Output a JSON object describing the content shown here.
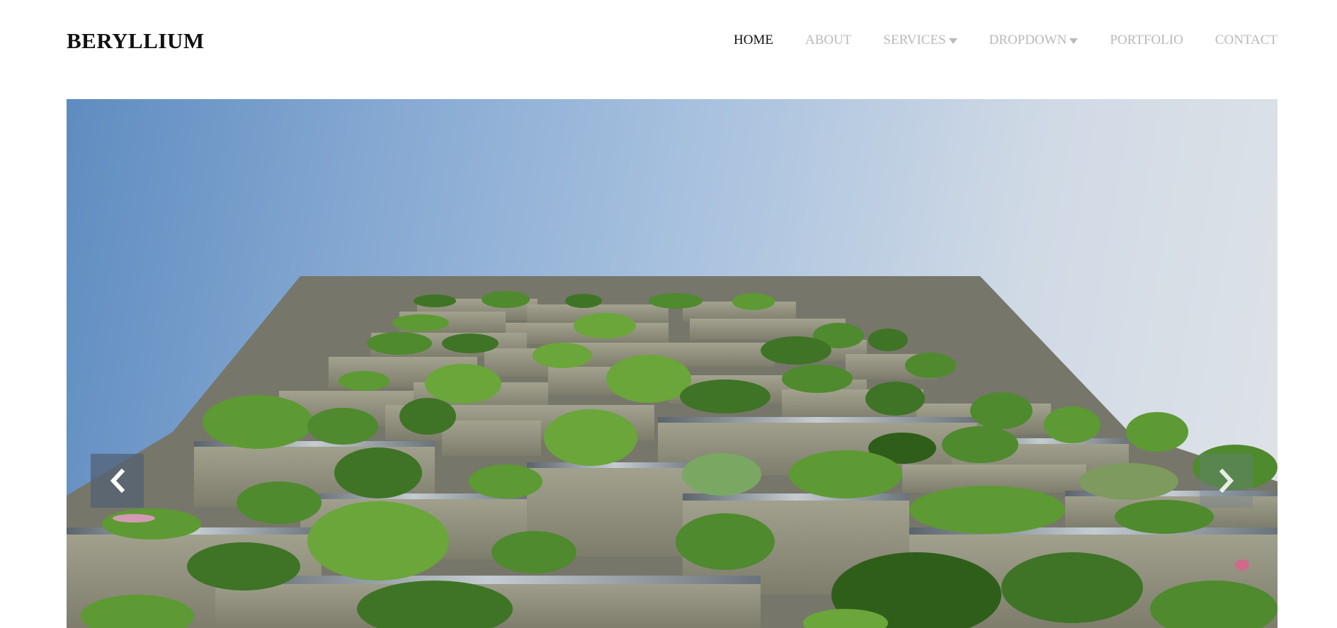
{
  "brand": "BERYLLIUM",
  "nav": {
    "items": [
      {
        "label": "HOME",
        "active": true,
        "dropdown": false
      },
      {
        "label": "ABOUT",
        "active": false,
        "dropdown": false
      },
      {
        "label": "SERVICES",
        "active": false,
        "dropdown": true
      },
      {
        "label": "DROPDOWN",
        "active": false,
        "dropdown": true
      },
      {
        "label": "PORTFOLIO",
        "active": false,
        "dropdown": false
      },
      {
        "label": "CONTACT",
        "active": false,
        "dropdown": false
      }
    ]
  },
  "hero": {
    "image": "vertical-forest-tower-photo",
    "controls": {
      "prev_icon": "chevron-left-icon",
      "next_icon": "chevron-right-icon"
    }
  },
  "colors": {
    "brand_text": "#111111",
    "nav_active": "#111111",
    "nav_inactive": "#b9b9b9",
    "sky_left": "#5f8cc0",
    "sky_right": "#dfe3e8",
    "foliage": "#4f8a2e",
    "balcony": "#8e8d7c"
  }
}
